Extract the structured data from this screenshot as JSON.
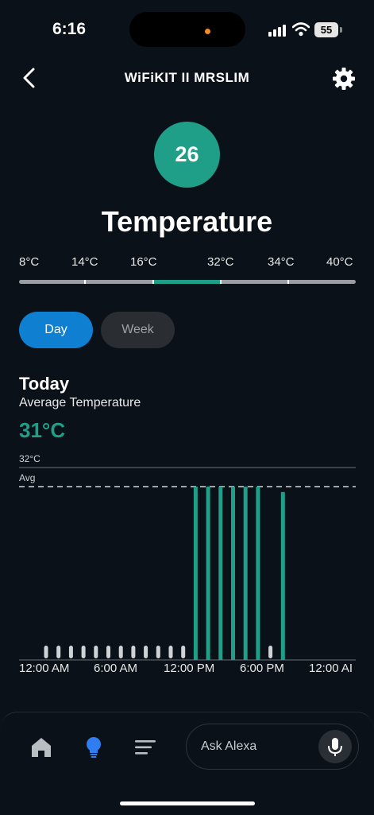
{
  "status_bar": {
    "time": "6:16",
    "battery": "55"
  },
  "header": {
    "title": "WiFiKIT II MRSLIM"
  },
  "current": {
    "value": "26",
    "label": "Temperature"
  },
  "scale": {
    "labels": [
      "8°C",
      "14°C",
      "16°C",
      "32°C",
      "34°C",
      "40°C"
    ]
  },
  "tabs": {
    "day": "Day",
    "week": "Week"
  },
  "summary": {
    "heading": "Today",
    "avg_label": "Average Temperature",
    "avg_value": "31°C"
  },
  "chart_data": {
    "type": "bar",
    "y_top_label": "32°C",
    "avg_line_label": "Avg",
    "x_tick_labels": [
      "12:00 AM",
      "6:00 AM",
      "12:00 PM",
      "6:00 PM",
      "12:00 AI"
    ],
    "hours": [
      0,
      1,
      2,
      3,
      4,
      5,
      6,
      7,
      8,
      9,
      10,
      11,
      12,
      13,
      14,
      15,
      16,
      17,
      18,
      19
    ],
    "values": [
      null,
      null,
      null,
      null,
      null,
      null,
      null,
      null,
      null,
      null,
      null,
      null,
      32,
      32,
      32,
      32,
      32,
      32,
      null,
      31
    ],
    "ylim": [
      0,
      32
    ],
    "colors": {
      "active": "#1f9e88",
      "inactive": "#cfd3d6",
      "avg_line": "#ffffff"
    }
  },
  "bottom": {
    "ask_placeholder": "Ask Alexa"
  },
  "icons": [
    "back-icon",
    "gear-icon",
    "home-icon",
    "lightbulb-icon",
    "menu-icon",
    "microphone-icon"
  ]
}
